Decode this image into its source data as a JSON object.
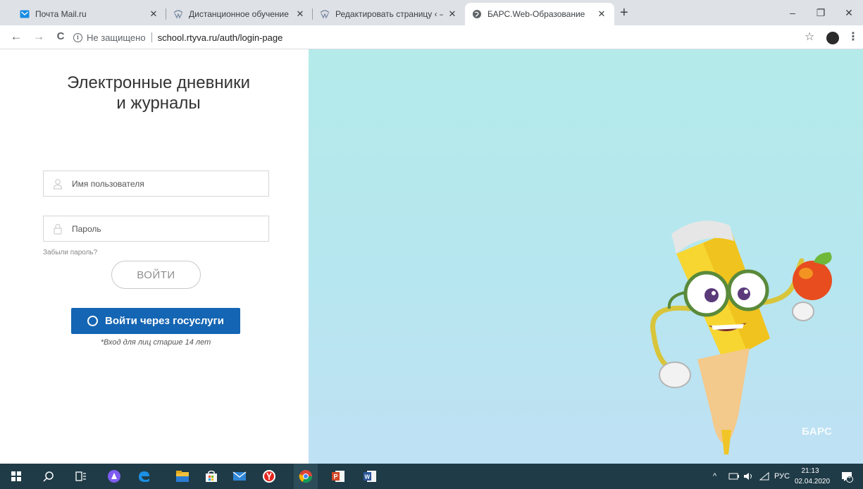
{
  "browser": {
    "tabs": [
      {
        "title": "Почта Mail.ru",
        "icon": "mail-icon",
        "active": false
      },
      {
        "title": "Дистанционное обучение",
        "icon": "wordpress-icon",
        "active": false
      },
      {
        "title": "Редактировать страницу ‹ — W",
        "icon": "wordpress-icon",
        "active": false
      },
      {
        "title": "БАРС.Web-Образование",
        "icon": "globe-icon",
        "active": true
      }
    ],
    "new_tab": "+",
    "window_controls": {
      "minimize": "–",
      "restore": "❐",
      "close": "✕"
    },
    "back": "←",
    "forward": "→",
    "reload": "C",
    "security_label": "Не защищено",
    "url": "school.rtyva.ru/auth/login-page",
    "bookmark": "☆",
    "menu": "⋮"
  },
  "login": {
    "heading_line1": "Электронные дневники",
    "heading_line2": "и журналы",
    "username_placeholder": "Имя пользователя",
    "password_placeholder": "Пароль",
    "forgot_password": "Забыли пароль?",
    "login_button": "ВОЙТИ",
    "gosuslugi_button": "Войти через госуслуги",
    "age_note": "*Вход для лиц старше 14 лет"
  },
  "brand": {
    "logo_text": "БАРС",
    "accent": "#1465b3",
    "background_top": "#b4ebea",
    "background_bottom": "#bfe1f4"
  },
  "taskbar": {
    "lang": "РУС",
    "time": "21:13",
    "date": "02.04.2020",
    "notifications": "4",
    "tray_arrow": "^"
  }
}
